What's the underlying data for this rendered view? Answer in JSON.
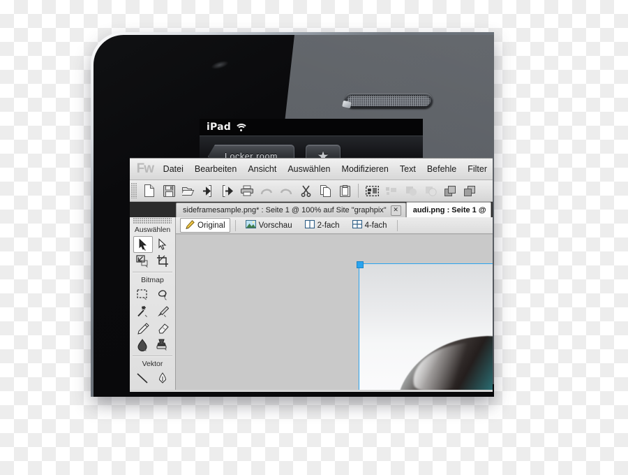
{
  "device": {
    "name": "ipad",
    "status_label": "iPad",
    "wifi_icon": "wifi-icon",
    "back_button_label": "Locker room",
    "favorite_icon": "star-icon",
    "speaker_icon": "speaker-grille-icon"
  },
  "app": {
    "logo_text": "Fw",
    "menu": [
      {
        "label": "Datei"
      },
      {
        "label": "Bearbeiten"
      },
      {
        "label": "Ansicht"
      },
      {
        "label": "Auswählen"
      },
      {
        "label": "Modifizieren"
      },
      {
        "label": "Text"
      },
      {
        "label": "Befehle"
      },
      {
        "label": "Filter"
      }
    ],
    "toolbar": [
      {
        "icon": "new-document-icon",
        "enabled": true
      },
      {
        "icon": "save-icon",
        "enabled": true
      },
      {
        "icon": "open-folder-icon",
        "enabled": true
      },
      {
        "icon": "import-icon",
        "enabled": true
      },
      {
        "icon": "export-icon",
        "enabled": true
      },
      {
        "icon": "print-icon",
        "enabled": true
      },
      {
        "icon": "undo-icon",
        "enabled": false
      },
      {
        "icon": "redo-icon",
        "enabled": false
      },
      {
        "icon": "cut-icon",
        "enabled": true
      },
      {
        "icon": "copy-icon",
        "enabled": true
      },
      {
        "icon": "paste-icon",
        "enabled": true
      },
      {
        "icon": "marquee-select-icon",
        "enabled": true
      },
      {
        "icon": "select-behind-icon",
        "enabled": false
      },
      {
        "icon": "union-shapes-icon",
        "enabled": false
      },
      {
        "icon": "subtract-shapes-icon",
        "enabled": false
      },
      {
        "icon": "bring-forward-icon",
        "enabled": true
      },
      {
        "icon": "send-backward-icon",
        "enabled": true
      }
    ],
    "document_tabs": [
      {
        "title": "sideframesample.png* : Seite 1 @ 100% auf Site \"graphpix\"",
        "active": false,
        "close_label": "✕"
      },
      {
        "title": "audi.png : Seite 1 @",
        "active": true,
        "close_label": ""
      }
    ],
    "view_modes": [
      {
        "label": "Original",
        "icon": "pencil-icon",
        "active": true
      },
      {
        "label": "Vorschau",
        "icon": "image-preview-icon",
        "active": false
      },
      {
        "label": "2-fach",
        "icon": "split-two-icon",
        "active": false
      },
      {
        "label": "4-fach",
        "icon": "split-four-icon",
        "active": false
      }
    ],
    "tools_panel": {
      "groups": [
        {
          "title": "Auswählen",
          "tools": [
            {
              "icon": "pointer-tool-icon",
              "selected": true,
              "has_menu": true
            },
            {
              "icon": "subselection-tool-icon",
              "selected": false,
              "has_menu": false
            },
            {
              "icon": "scale-tool-icon",
              "selected": false,
              "has_menu": true
            },
            {
              "icon": "crop-tool-icon",
              "selected": false,
              "has_menu": true
            }
          ]
        },
        {
          "title": "Bitmap",
          "tools": [
            {
              "icon": "marquee-tool-icon",
              "selected": false,
              "has_menu": true
            },
            {
              "icon": "lasso-tool-icon",
              "selected": false,
              "has_menu": true
            },
            {
              "icon": "magic-wand-tool-icon",
              "selected": false,
              "has_menu": true
            },
            {
              "icon": "brush-tool-icon",
              "selected": false,
              "has_menu": true
            },
            {
              "icon": "pencil-tool-icon",
              "selected": false,
              "has_menu": false
            },
            {
              "icon": "eraser-tool-icon",
              "selected": false,
              "has_menu": false
            },
            {
              "icon": "blur-tool-icon",
              "selected": false,
              "has_menu": true
            },
            {
              "icon": "rubber-stamp-tool-icon",
              "selected": false,
              "has_menu": true
            }
          ]
        },
        {
          "title": "Vektor",
          "tools": [
            {
              "icon": "line-tool-icon",
              "selected": false,
              "has_menu": false
            },
            {
              "icon": "pen-tool-icon",
              "selected": false,
              "has_menu": false
            }
          ]
        }
      ]
    },
    "canvas": {
      "selection_handle": "selection-handle-nw",
      "artwork": "audi-car-photo"
    }
  },
  "colors": {
    "selection_blue": "#29a3ee",
    "canvas_gray": "#c9c9c9",
    "chrome_gray": "#e2e2e2",
    "device_black": "#0a0a0c",
    "car_teal": "#5fb2b6"
  }
}
